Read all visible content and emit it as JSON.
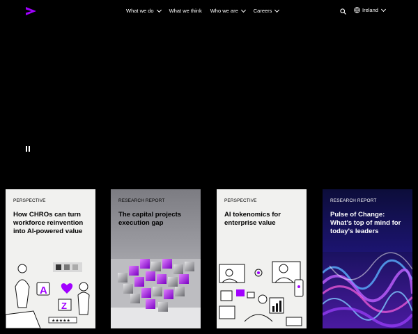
{
  "nav": {
    "items": [
      {
        "label": "What we do",
        "has_dropdown": true
      },
      {
        "label": "What we think",
        "has_dropdown": false
      },
      {
        "label": "Who we are",
        "has_dropdown": true
      },
      {
        "label": "Careers",
        "has_dropdown": true
      }
    ],
    "language": "Ireland"
  },
  "colors": {
    "brand_purple": "#a100ff",
    "background": "#000000"
  },
  "cards": [
    {
      "kicker": "PERSPECTIVE",
      "title": "How CHROs can turn workforce reinvention into AI-powered value"
    },
    {
      "kicker": "RESEARCH REPORT",
      "title": "The capital projects execution gap"
    },
    {
      "kicker": "PERSPECTIVE",
      "title": "AI tokenomics for enterprise value"
    },
    {
      "kicker": "RESEARCH REPORT",
      "title": "Pulse of Change: What's top of mind for today's leaders"
    }
  ],
  "card_illustration_letters": [
    "A",
    "Z"
  ]
}
